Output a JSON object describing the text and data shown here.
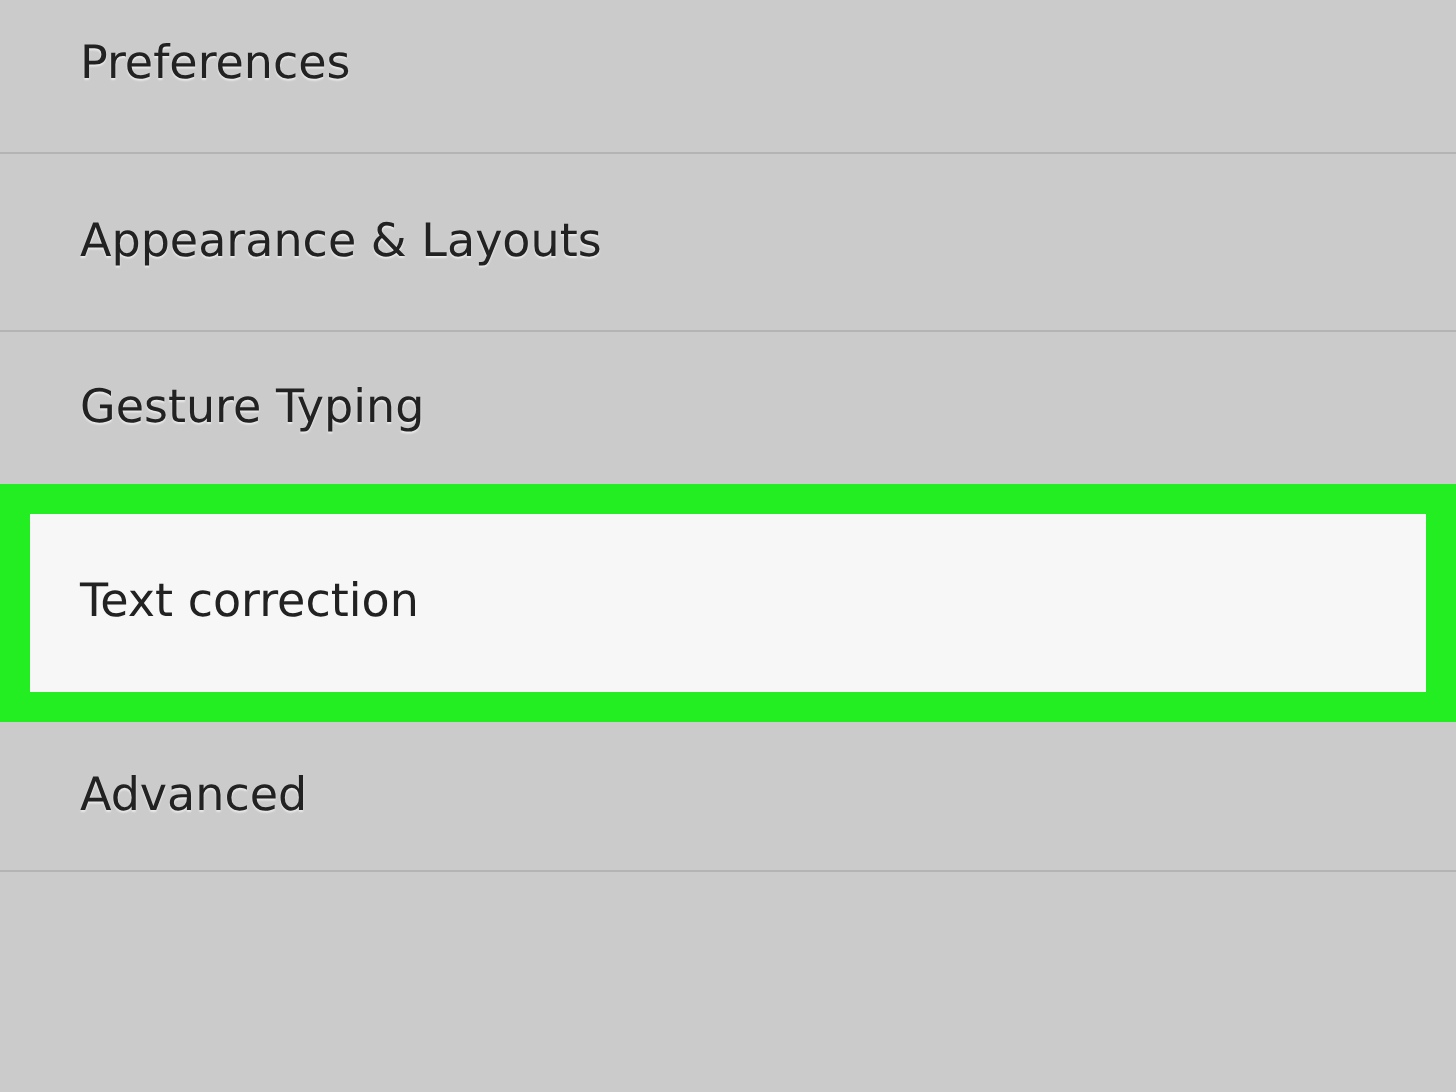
{
  "settings_items": [
    {
      "label": "Preferences",
      "highlighted": false
    },
    {
      "label": "Appearance & Layouts",
      "highlighted": false
    },
    {
      "label": "Gesture Typing",
      "highlighted": false
    },
    {
      "label": "Text correction",
      "highlighted": true
    },
    {
      "label": "Advanced",
      "highlighted": false
    }
  ]
}
